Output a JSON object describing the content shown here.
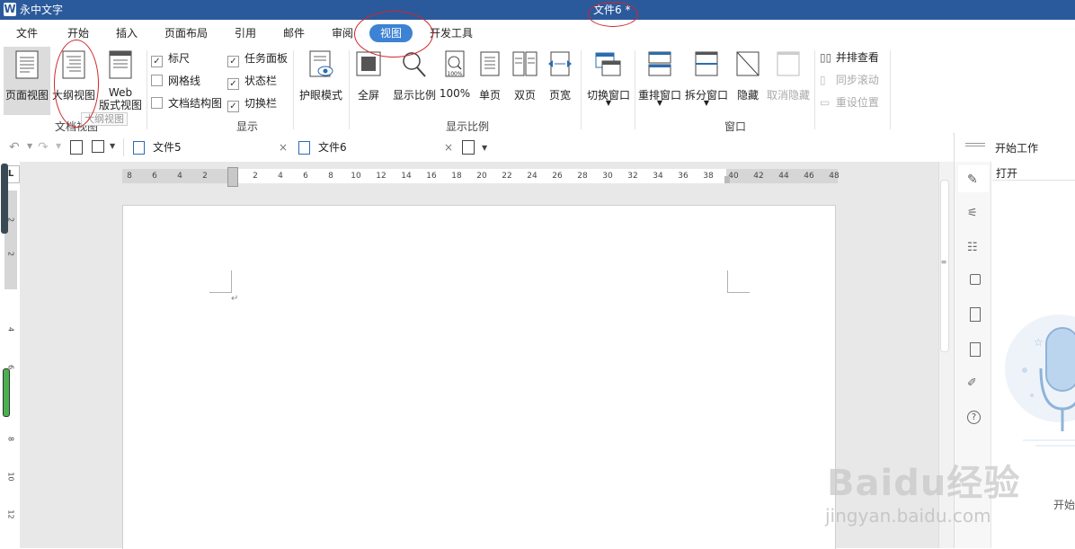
{
  "titlebar": {
    "app_name": "永中文字",
    "doc_title": "文件6 *",
    "logo_letter": "W"
  },
  "menu": {
    "items": [
      "文件",
      "开始",
      "插入",
      "页面布局",
      "引用",
      "邮件",
      "审阅",
      "视图",
      "开发工具"
    ],
    "active": "视图"
  },
  "ribbon": {
    "doc_views": {
      "page_view": "页面视图",
      "outline_view": "大纲视图",
      "web_view_1": "Web",
      "web_view_2": "版式视图",
      "group_label": "文档视图",
      "tooltip": "大纲视图"
    },
    "show": {
      "ruler": "标尺",
      "gridlines": "网格线",
      "doc_map": "文档结构图",
      "task_pane": "任务面板",
      "status_bar": "状态栏",
      "switch_bar": "切换栏",
      "group_label": "显示"
    },
    "eye_mode": "护眼模式",
    "zoom": {
      "full_screen": "全屏",
      "zoom_ratio": "显示比例",
      "hundred": "100%",
      "hundred_icon_text": "100%",
      "single_page": "单页",
      "double_page": "双页",
      "page_width": "页宽",
      "group_label": "显示比例"
    },
    "window": {
      "switch_window": "切换窗口",
      "rearrange": "重排窗口",
      "split": "拆分窗口",
      "hide": "隐藏",
      "unhide": "取消隐藏",
      "side_by_side": "并排查看",
      "sync_scroll": "同步滚动",
      "reset_position": "重设位置",
      "group_label": "窗口"
    }
  },
  "tabs": {
    "tab1": "文件5",
    "tab2": "文件6",
    "close_glyph": "×"
  },
  "ruler": {
    "h_left": [
      "8",
      "6",
      "4",
      "2"
    ],
    "h_right": [
      "2",
      "4",
      "6",
      "8",
      "10",
      "12",
      "14",
      "16",
      "18",
      "20",
      "22",
      "24",
      "26",
      "28",
      "30",
      "32",
      "34",
      "36",
      "38",
      "40",
      "42",
      "44",
      "46",
      "48"
    ],
    "v": [
      "2",
      "2",
      "4",
      "6",
      "8",
      "10",
      "12"
    ]
  },
  "document": {
    "paragraph_mark": "↵"
  },
  "right_pane": {
    "title": "开始工作",
    "open": "打开",
    "start_small": "开始"
  },
  "watermark": {
    "brand": "Baidu经验",
    "url": "jingyan.baidu.com"
  },
  "colors": {
    "title_bar": "#2b5a9c",
    "accent": "#3d82d4",
    "annotation": "#d0262a"
  }
}
